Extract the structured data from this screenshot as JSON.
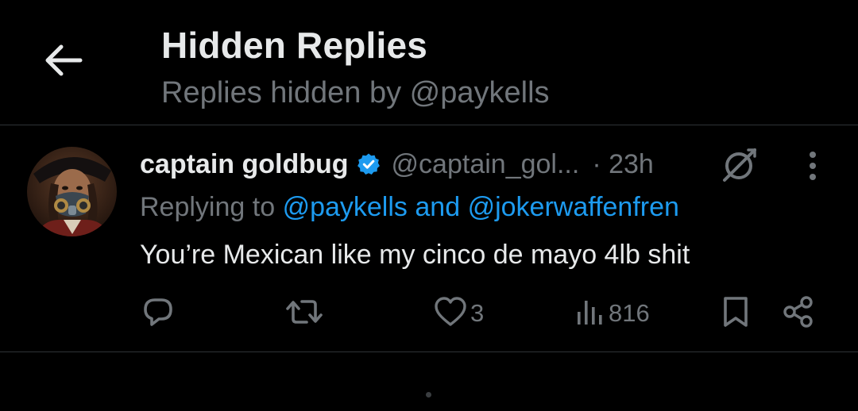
{
  "header": {
    "title": "Hidden Replies",
    "subtitle": "Replies hidden by @paykells"
  },
  "tweet": {
    "display_name": "captain goldbug",
    "handle": "@captain_gol...",
    "time": "· 23h",
    "replying_prefix": "Replying to",
    "replying_to": [
      "@paykells",
      "@jokerwaffenfren"
    ],
    "replying_joiner": "and",
    "text": "You’re Mexican like my cinco de mayo 4lb shit",
    "verified_color": "#1d9bf0"
  },
  "actions": {
    "reply_count": "",
    "retweet_count": "",
    "like_count": "3",
    "views_count": "816"
  },
  "icons": [
    "back-arrow-icon",
    "verified-badge-icon",
    "grok-icon",
    "more-icon",
    "reply-icon",
    "retweet-icon",
    "like-icon",
    "views-icon",
    "bookmark-icon",
    "share-icon"
  ],
  "colors": {
    "background": "#000000",
    "primary_text": "#e7e9ea",
    "secondary_text": "#71767b",
    "accent": "#1d9bf0",
    "divider": "#2f3336"
  }
}
